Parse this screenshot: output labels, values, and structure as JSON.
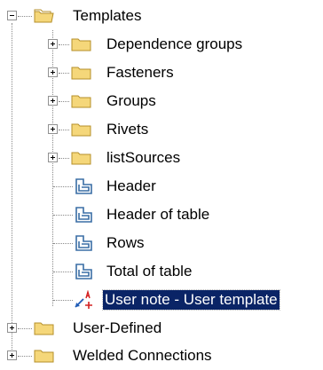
{
  "tree": {
    "root": {
      "label": "Templates",
      "expanded": true,
      "icon": "folder-open-icon",
      "children": [
        {
          "label": "Dependence groups",
          "icon": "folder-icon",
          "expandable": true
        },
        {
          "label": "Fasteners",
          "icon": "folder-icon",
          "expandable": true
        },
        {
          "label": "Groups",
          "icon": "folder-icon",
          "expandable": true
        },
        {
          "label": "Rivets",
          "icon": "folder-icon",
          "expandable": true
        },
        {
          "label": "listSources",
          "icon": "folder-icon",
          "expandable": true
        },
        {
          "label": "Header",
          "icon": "template-icon",
          "expandable": false
        },
        {
          "label": "Header of table",
          "icon": "template-icon",
          "expandable": false
        },
        {
          "label": "Rows",
          "icon": "template-icon",
          "expandable": false
        },
        {
          "label": "Total of table",
          "icon": "template-icon",
          "expandable": false
        },
        {
          "label": "User note - User template",
          "icon": "user-note-icon",
          "expandable": false,
          "selected": true
        }
      ]
    },
    "siblings": [
      {
        "label": "User-Defined",
        "icon": "folder-icon",
        "expandable": true
      },
      {
        "label": "Welded Connections",
        "icon": "folder-icon",
        "expandable": true
      }
    ]
  },
  "colors": {
    "folder_fill": "#f5d77a",
    "folder_stroke": "#b58f2a",
    "template_icon": "#3a6ea5",
    "selection_bg": "#0a2466",
    "selection_text": "#ffffff",
    "note_arrow": "#1d5ab5",
    "note_red": "#d42020"
  }
}
